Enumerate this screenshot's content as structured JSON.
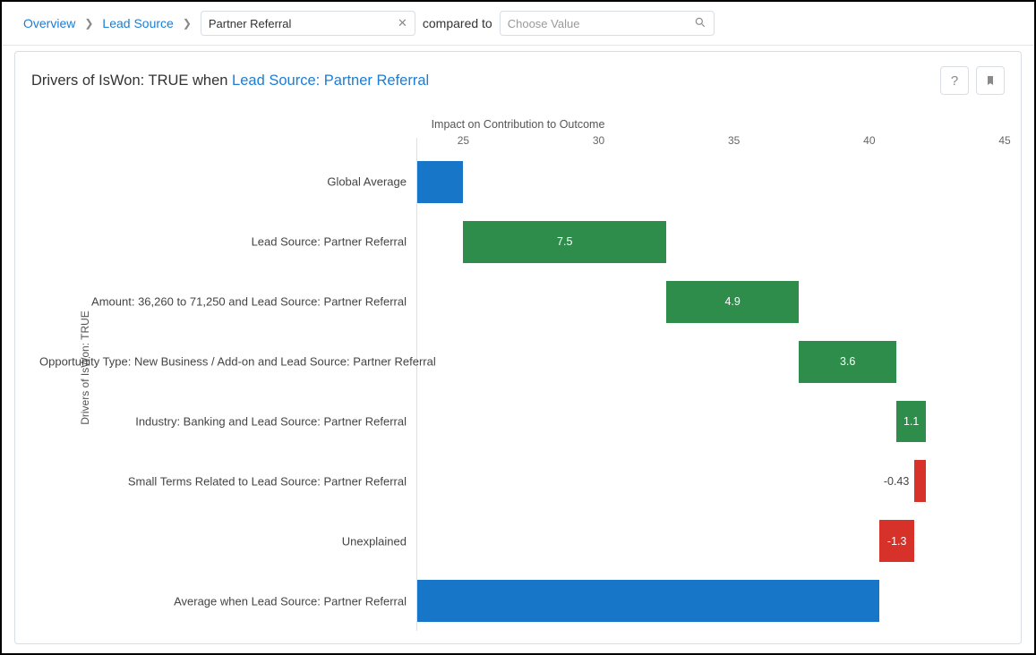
{
  "breadcrumb": {
    "overview": "Overview",
    "leadsource": "Lead Source"
  },
  "filter": {
    "value": "Partner Referral"
  },
  "compare": {
    "label": "compared to",
    "placeholder": "Choose Value"
  },
  "card": {
    "title_prefix": "Drivers of IsWon: TRUE when ",
    "title_link": "Lead Source: Partner Referral"
  },
  "chart_data": {
    "type": "bar",
    "title": "Impact on Contribution to Outcome",
    "xlabel": "Impact on Contribution to Outcome",
    "ylabel": "Drivers of IsWon: TRUE",
    "xlim": [
      23.3,
      45
    ],
    "ticks": [
      25,
      30,
      35,
      40,
      45
    ],
    "categories": [
      "Global Average",
      "Lead Source: Partner Referral",
      "Amount: 36,260 to 71,250 and Lead Source: Partner Referral",
      "Opportunity Type: New Business / Add-on and Lead Source: Partner Referral",
      "Industry: Banking and Lead Source: Partner Referral",
      "Small Terms Related to Lead Source: Partner Referral",
      "Unexplained",
      "Average when Lead Source: Partner Referral"
    ],
    "bars": [
      {
        "from": 23.3,
        "to": 25.0,
        "color": "blue",
        "label": ""
      },
      {
        "from": 25.0,
        "to": 32.5,
        "color": "green",
        "label": "7.5"
      },
      {
        "from": 32.5,
        "to": 37.4,
        "color": "green",
        "label": "4.9"
      },
      {
        "from": 37.4,
        "to": 41.0,
        "color": "green",
        "label": "3.6"
      },
      {
        "from": 41.0,
        "to": 42.1,
        "color": "green",
        "label": "1.1"
      },
      {
        "from": 41.67,
        "to": 42.1,
        "color": "red",
        "label": "-0.43",
        "label_outside": true
      },
      {
        "from": 40.37,
        "to": 41.67,
        "color": "red",
        "label": "-1.3"
      },
      {
        "from": 23.3,
        "to": 40.37,
        "color": "blue",
        "label": ""
      }
    ]
  }
}
